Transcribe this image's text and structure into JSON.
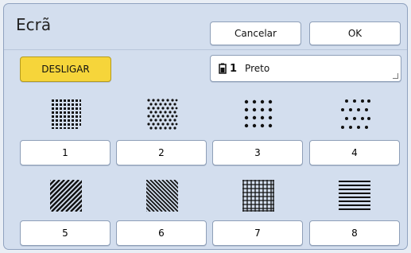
{
  "window": {
    "title": "Ecrã"
  },
  "toolbar": {
    "cancel_label": "Cancelar",
    "ok_label": "OK"
  },
  "controls": {
    "off_label": "DESLIGAR",
    "ink_number": "1",
    "ink_label": "Preto"
  },
  "patterns": [
    {
      "label": "1",
      "icon": "fine-dot-grid-icon"
    },
    {
      "label": "2",
      "icon": "fine-dot-stagger-icon"
    },
    {
      "label": "3",
      "icon": "coarse-dot-grid-icon"
    },
    {
      "label": "4",
      "icon": "coarse-dot-stagger-icon"
    },
    {
      "label": "5",
      "icon": "diagonal-lines-right-icon"
    },
    {
      "label": "6",
      "icon": "diagonal-lines-left-icon"
    },
    {
      "label": "7",
      "icon": "grid-crosshatch-icon"
    },
    {
      "label": "8",
      "icon": "horizontal-lines-icon"
    }
  ],
  "colors": {
    "panel": "#d3deee",
    "accent": "#f6d53a",
    "button": "#ffffff"
  }
}
